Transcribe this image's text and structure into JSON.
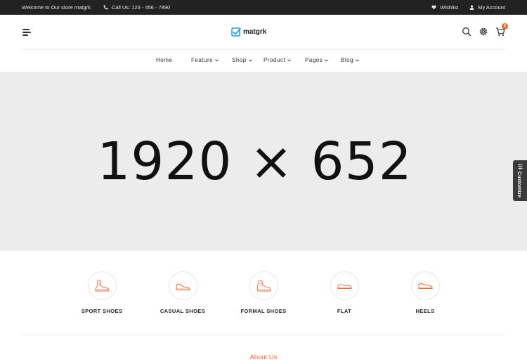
{
  "topbar": {
    "welcome": "Welcome to Our store matgrk",
    "phone": "Call Us: 123 - 456 - 7890",
    "wishlist": "Wishlist",
    "account": "My Account"
  },
  "header": {
    "logo": "matgrk",
    "cart_count": "2"
  },
  "nav": {
    "items": [
      {
        "label": "Home",
        "dropdown": false
      },
      {
        "label": "Feature",
        "dropdown": true
      },
      {
        "label": "Shop",
        "dropdown": true
      },
      {
        "label": "Product",
        "dropdown": true
      },
      {
        "label": "Pages",
        "dropdown": true
      },
      {
        "label": "Blog",
        "dropdown": true
      }
    ]
  },
  "hero": {
    "placeholder": "1920 × 652"
  },
  "customize": {
    "label": "Customize"
  },
  "categories": [
    {
      "label": "SPORT SHOES",
      "icon": "sport-shoe-icon"
    },
    {
      "label": "CASUAL SHOES",
      "icon": "casual-shoe-icon"
    },
    {
      "label": "FORMAL SHOES",
      "icon": "formal-shoe-icon"
    },
    {
      "label": "FLAT",
      "icon": "flat-shoe-icon"
    },
    {
      "label": "HEELS",
      "icon": "heel-shoe-icon"
    }
  ],
  "section": {
    "about_title": "About Us"
  },
  "colors": {
    "accent": "#e06f3c",
    "topbar_bg": "#222222",
    "hero_bg": "#ececec",
    "logo_blue": "#2a9fd6"
  }
}
